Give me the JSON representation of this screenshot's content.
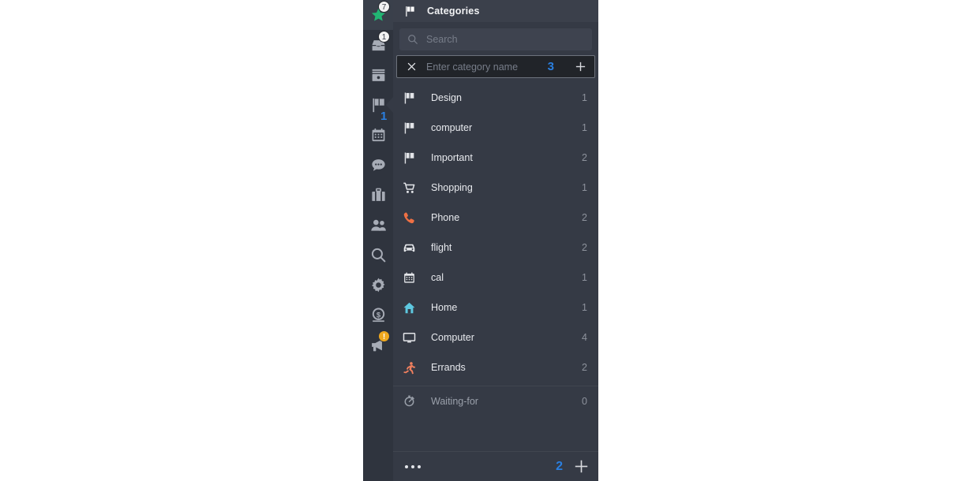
{
  "app": {
    "accent_blue": "#2a7fe0",
    "panel_bg": "#353a45",
    "rail_bg": "#2f343e"
  },
  "rail": {
    "items": [
      {
        "name": "star-icon",
        "badge": "7",
        "badge_kind": "light",
        "selected": true,
        "annotation": ""
      },
      {
        "name": "inbox-icon",
        "badge": "1",
        "badge_kind": "light",
        "selected": false,
        "annotation": ""
      },
      {
        "name": "archive-icon",
        "badge": "",
        "badge_kind": "",
        "selected": false,
        "annotation": ""
      },
      {
        "name": "flag-icon",
        "badge": "",
        "badge_kind": "",
        "selected": false,
        "annotation": "1"
      },
      {
        "name": "calendar-icon",
        "badge": "",
        "badge_kind": "",
        "selected": false,
        "annotation": ""
      },
      {
        "name": "chat-icon",
        "badge": "",
        "badge_kind": "",
        "selected": false,
        "annotation": ""
      },
      {
        "name": "briefcase-icon",
        "badge": "",
        "badge_kind": "",
        "selected": false,
        "annotation": ""
      },
      {
        "name": "contacts-icon",
        "badge": "",
        "badge_kind": "",
        "selected": false,
        "annotation": ""
      },
      {
        "name": "search-icon",
        "badge": "",
        "badge_kind": "",
        "selected": false,
        "annotation": ""
      },
      {
        "name": "gear-icon",
        "badge": "",
        "badge_kind": "",
        "selected": false,
        "annotation": ""
      },
      {
        "name": "dollar-icon",
        "badge": "",
        "badge_kind": "",
        "selected": false,
        "annotation": ""
      },
      {
        "name": "megaphone-icon",
        "badge": "!",
        "badge_kind": "warn",
        "selected": false,
        "annotation": ""
      }
    ]
  },
  "header": {
    "icon": "flag-icon",
    "title": "Categories"
  },
  "search": {
    "icon": "search-icon",
    "placeholder": "Search",
    "value": ""
  },
  "new_category": {
    "clear_icon": "close-icon",
    "placeholder": "Enter category name",
    "value": "",
    "annotation": "3",
    "add_icon": "plus-icon"
  },
  "categories": [
    {
      "icon": "flag-icon",
      "label": "Design",
      "count": "1",
      "dim": false,
      "separator": false
    },
    {
      "icon": "flag-icon",
      "label": "computer",
      "count": "1",
      "dim": false,
      "separator": false
    },
    {
      "icon": "flag-icon",
      "label": "Important",
      "count": "2",
      "dim": false,
      "separator": false
    },
    {
      "icon": "cart-icon",
      "label": "Shopping",
      "count": "1",
      "dim": false,
      "separator": false
    },
    {
      "icon": "phone-icon",
      "label": "Phone",
      "count": "2",
      "dim": false,
      "separator": false
    },
    {
      "icon": "car-icon",
      "label": "flight",
      "count": "2",
      "dim": false,
      "separator": false
    },
    {
      "icon": "calendar-icon",
      "label": "cal",
      "count": "1",
      "dim": false,
      "separator": false
    },
    {
      "icon": "home-icon",
      "label": "Home",
      "count": "1",
      "dim": false,
      "separator": false
    },
    {
      "icon": "monitor-icon",
      "label": "Computer",
      "count": "4",
      "dim": false,
      "separator": false
    },
    {
      "icon": "runner-icon",
      "label": "Errands",
      "count": "2",
      "dim": false,
      "separator": false
    },
    {
      "icon": "stopwatch-icon",
      "label": "Waiting-for",
      "count": "0",
      "dim": true,
      "separator": true
    }
  ],
  "footer": {
    "more_icon": "ellipsis-icon",
    "annotation": "2",
    "add_icon": "plus-icon"
  }
}
